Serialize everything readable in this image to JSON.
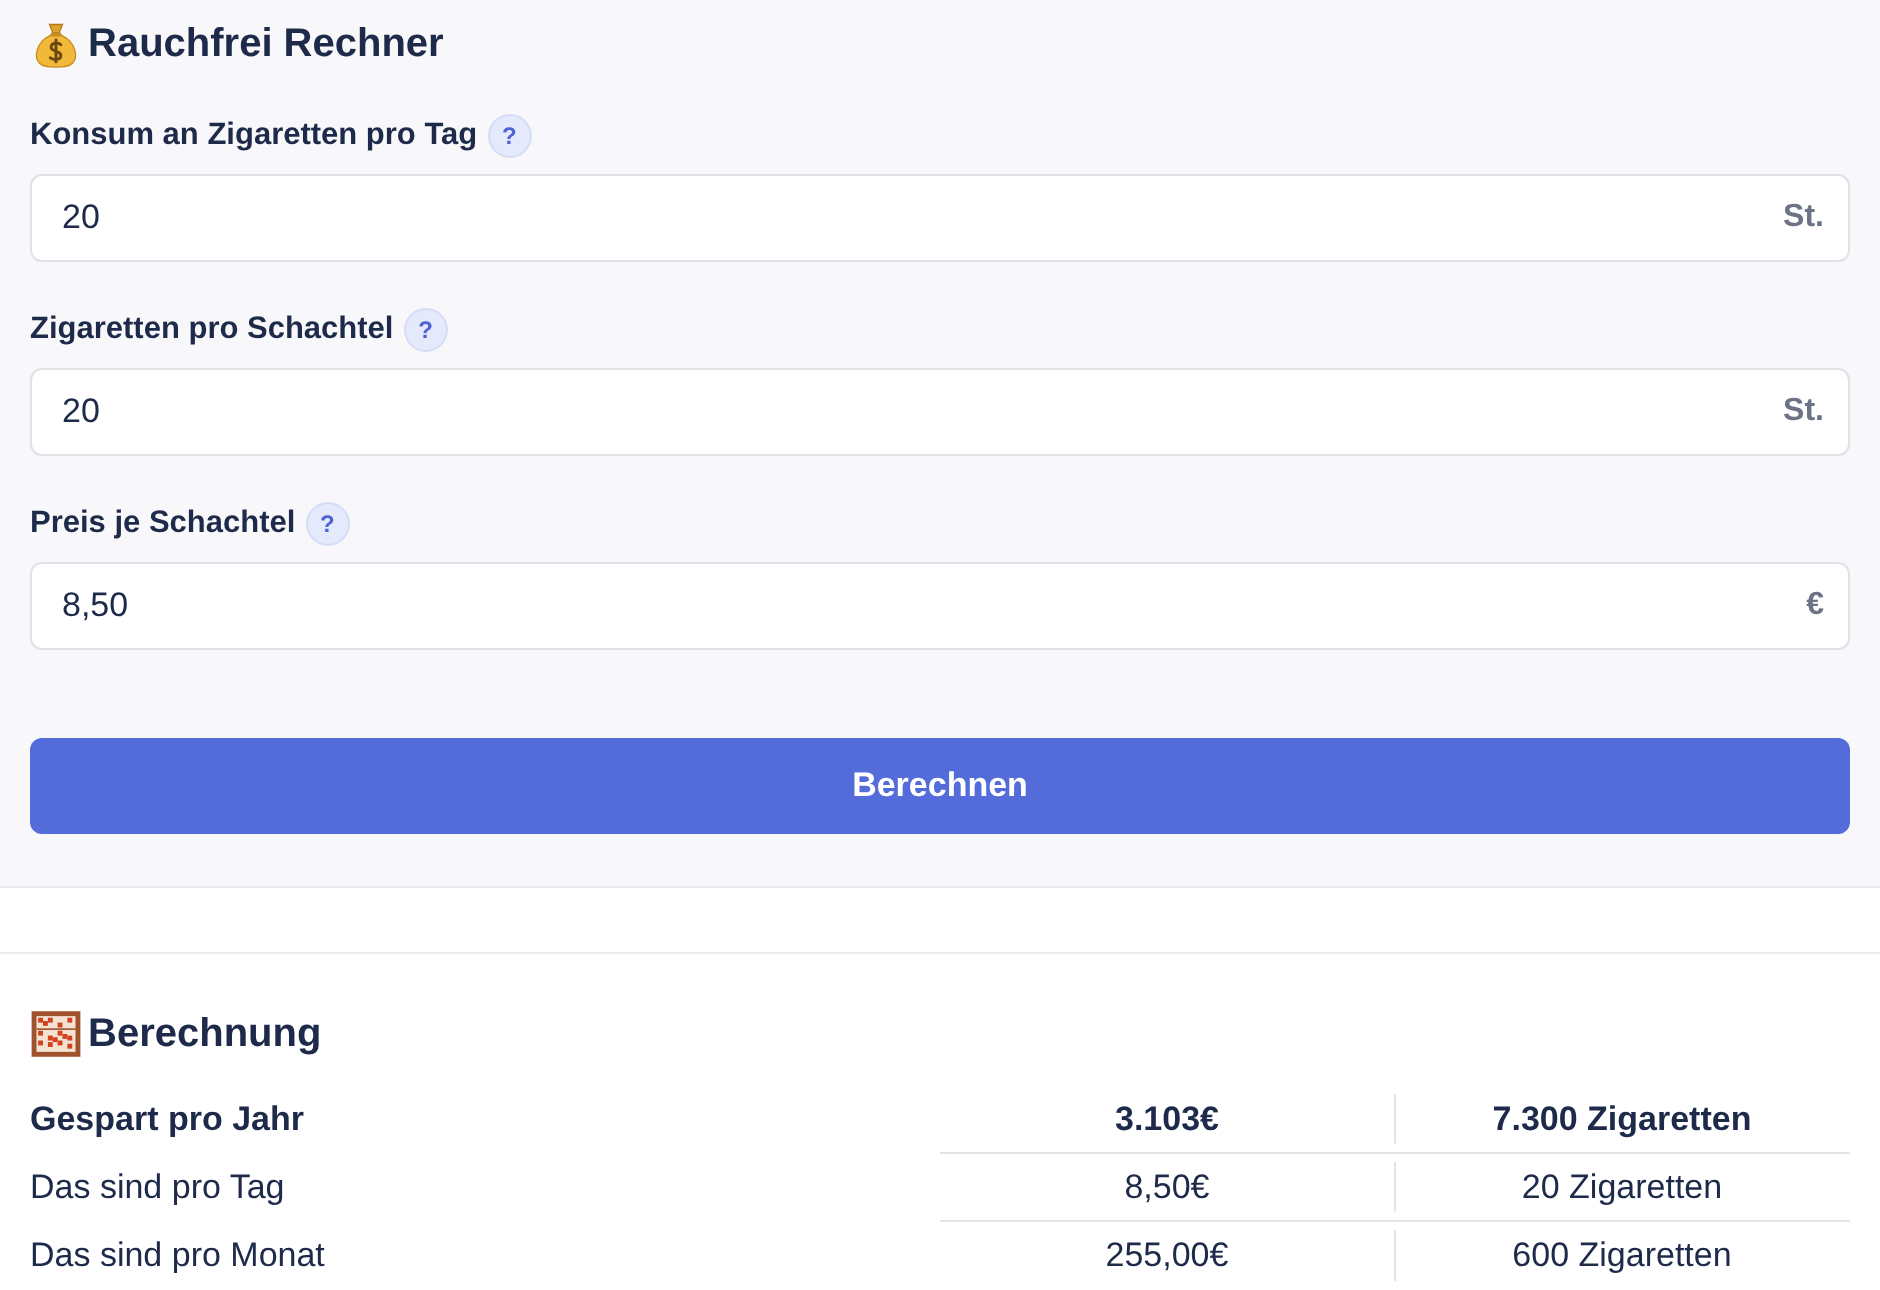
{
  "calculator": {
    "title": "Rauchfrei Rechner",
    "fields": [
      {
        "label": "Konsum an Zigaretten pro Tag",
        "help": "?",
        "value": "20",
        "unit": "St."
      },
      {
        "label": "Zigaretten pro Schachtel",
        "help": "?",
        "value": "20",
        "unit": "St."
      },
      {
        "label": "Preis je Schachtel",
        "help": "?",
        "value": "8,50",
        "unit": "€"
      }
    ],
    "button": "Berechnen"
  },
  "results": {
    "title": "Berechnung",
    "rows": [
      {
        "kind": "total",
        "cells": [
          "Gespart pro Jahr",
          "3.103€",
          "7.300 Zigaretten"
        ]
      },
      {
        "kind": "detail",
        "cells": [
          "Das sind pro Tag",
          "8,50€",
          "20 Zigaretten"
        ]
      },
      {
        "kind": "detail",
        "cells": [
          "Das sind pro Monat",
          "255,00€",
          "600 Zigaretten"
        ]
      }
    ]
  }
}
